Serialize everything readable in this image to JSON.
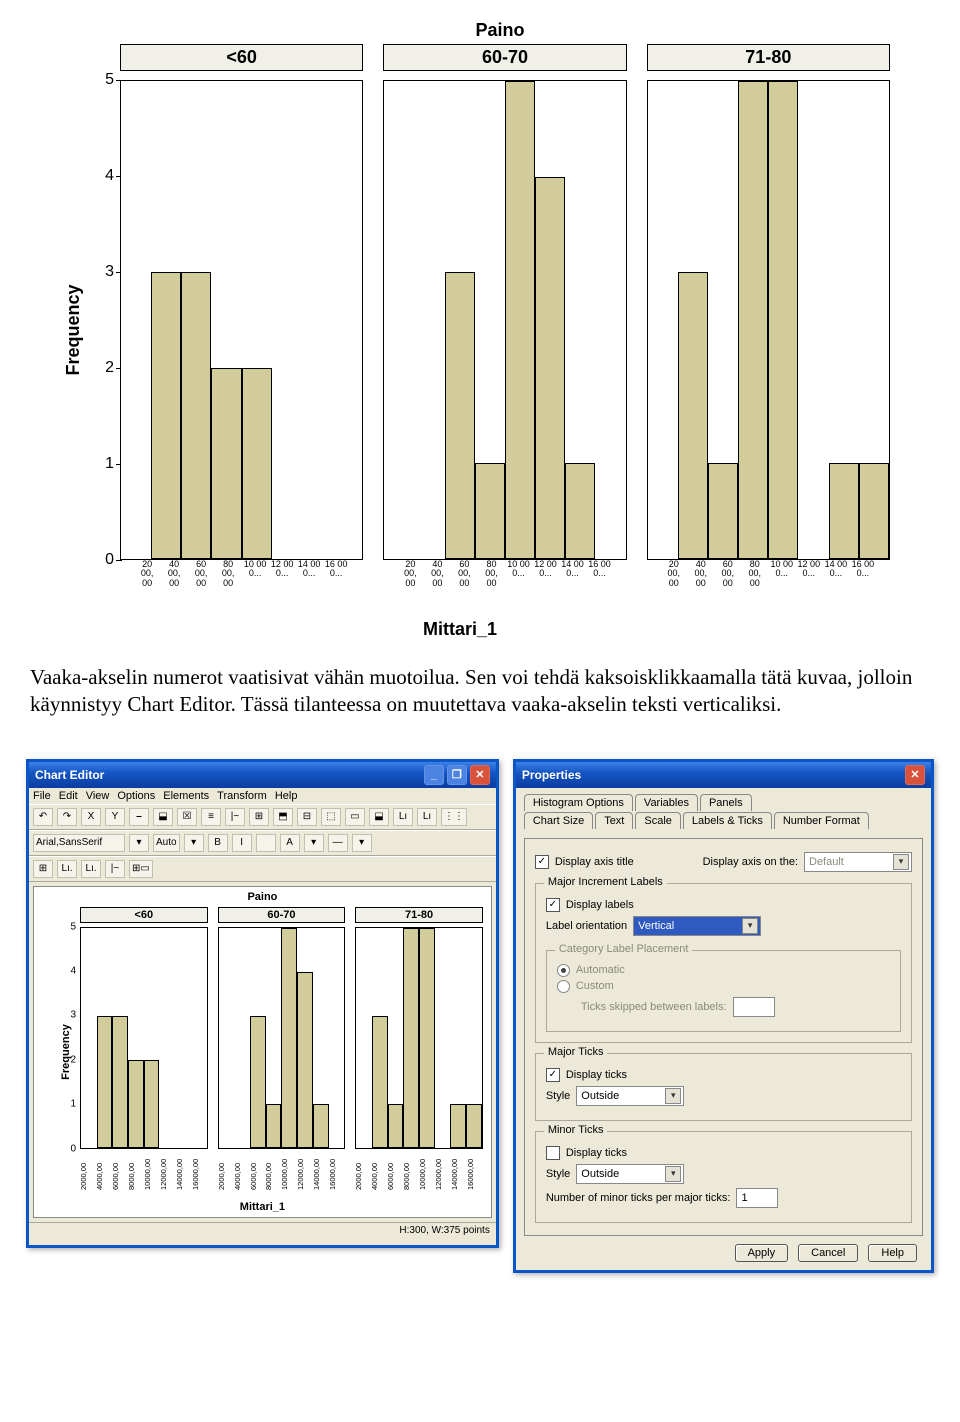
{
  "chart_data": {
    "type": "bar",
    "title": "Paino",
    "ylabel": "Frequency",
    "xlabel": "Mittari_1",
    "ylim": [
      0,
      5
    ],
    "yticks": [
      0,
      1,
      2,
      3,
      4,
      5
    ],
    "panels": [
      "<60",
      "60-70",
      "71-80"
    ],
    "categories": [
      "20 00, 00",
      "40 00, 00",
      "60 00, 00",
      "80 00, 00",
      "10 00 0...",
      "12 00 0...",
      "14 00 0...",
      "16 00 0..."
    ],
    "series": [
      {
        "name": "<60",
        "values": [
          0,
          3,
          3,
          2,
          2,
          0,
          0,
          0
        ]
      },
      {
        "name": "60-70",
        "values": [
          0,
          0,
          3,
          1,
          5,
          4,
          1,
          0
        ]
      },
      {
        "name": "71-80",
        "values": [
          0,
          3,
          1,
          5,
          5,
          0,
          1,
          1
        ]
      }
    ]
  },
  "paragraph": "Vaaka-akselin numerot vaatisivat vähän muotoilua. Sen voi tehdä kaksoisklikkaamalla tätä kuvaa, jolloin käynnistyy Chart Editor. Tässä tilanteessa on muutettava vaaka-akselin teksti verticaliksi.",
  "chartEditor": {
    "title": "Chart Editor",
    "menus": [
      "File",
      "Edit",
      "View",
      "Options",
      "Elements",
      "Transform",
      "Help"
    ],
    "toolbar1": [
      "↶",
      "↷",
      "X",
      "Y",
      "⎯",
      "⬓",
      "☒",
      "≡",
      "|~",
      "⊞",
      "⬒",
      "⊟",
      "⬚",
      "▭",
      "⬓",
      "Lı",
      "Lı",
      "⋮⋮"
    ],
    "font": "Arial,SansSerif",
    "fontCtl": [
      "▾",
      "Auto",
      "▾",
      "B",
      "I",
      "",
      "A",
      "▾",
      "—",
      "▾"
    ],
    "toolbar2": [
      "⊞",
      "Lı.",
      "Lı.",
      "|~",
      "⊞▭"
    ],
    "chart": {
      "title": "Paino",
      "panels": [
        "<60",
        "60-70",
        "71-80"
      ],
      "ylabel": "Frequency",
      "xlabel": "Mittari_1",
      "yticks": [
        0,
        1,
        2,
        3,
        4,
        5
      ],
      "xticks": [
        "2000,00",
        "4000,00",
        "6000,00",
        "8000,00",
        "10000,00",
        "12000,00",
        "14000,00",
        "16000,00"
      ]
    },
    "status": "H:300, W:375 points"
  },
  "properties": {
    "title": "Properties",
    "backTabs": [
      "Histogram Options",
      "Variables",
      "Panels"
    ],
    "frontTabs": [
      "Chart Size",
      "Text",
      "Scale",
      "Labels & Ticks",
      "Number Format"
    ],
    "activeTab": "Labels & Ticks",
    "displayAxisTitle": {
      "label": "Display axis title",
      "checked": true
    },
    "displayAxisOn": {
      "label": "Display axis on the:",
      "value": "Default"
    },
    "majorInc": {
      "legend": "Major Increment Labels",
      "displayLabels": {
        "label": "Display labels",
        "checked": true
      },
      "orientation": {
        "label": "Label orientation",
        "value": "Vertical"
      },
      "placement": {
        "legend": "Category Label Placement",
        "auto": "Automatic",
        "custom": "Custom",
        "skip": "Ticks skipped between labels:"
      }
    },
    "majorTicks": {
      "legend": "Major Ticks",
      "display": {
        "label": "Display ticks",
        "checked": true
      },
      "style": {
        "label": "Style",
        "value": "Outside"
      }
    },
    "minorTicks": {
      "legend": "Minor Ticks",
      "display": {
        "label": "Display ticks",
        "checked": false
      },
      "style": {
        "label": "Style",
        "value": "Outside"
      },
      "num": {
        "label": "Number of minor ticks per major ticks:",
        "value": "1"
      }
    },
    "buttons": {
      "apply": "Apply",
      "cancel": "Cancel",
      "help": "Help"
    }
  }
}
